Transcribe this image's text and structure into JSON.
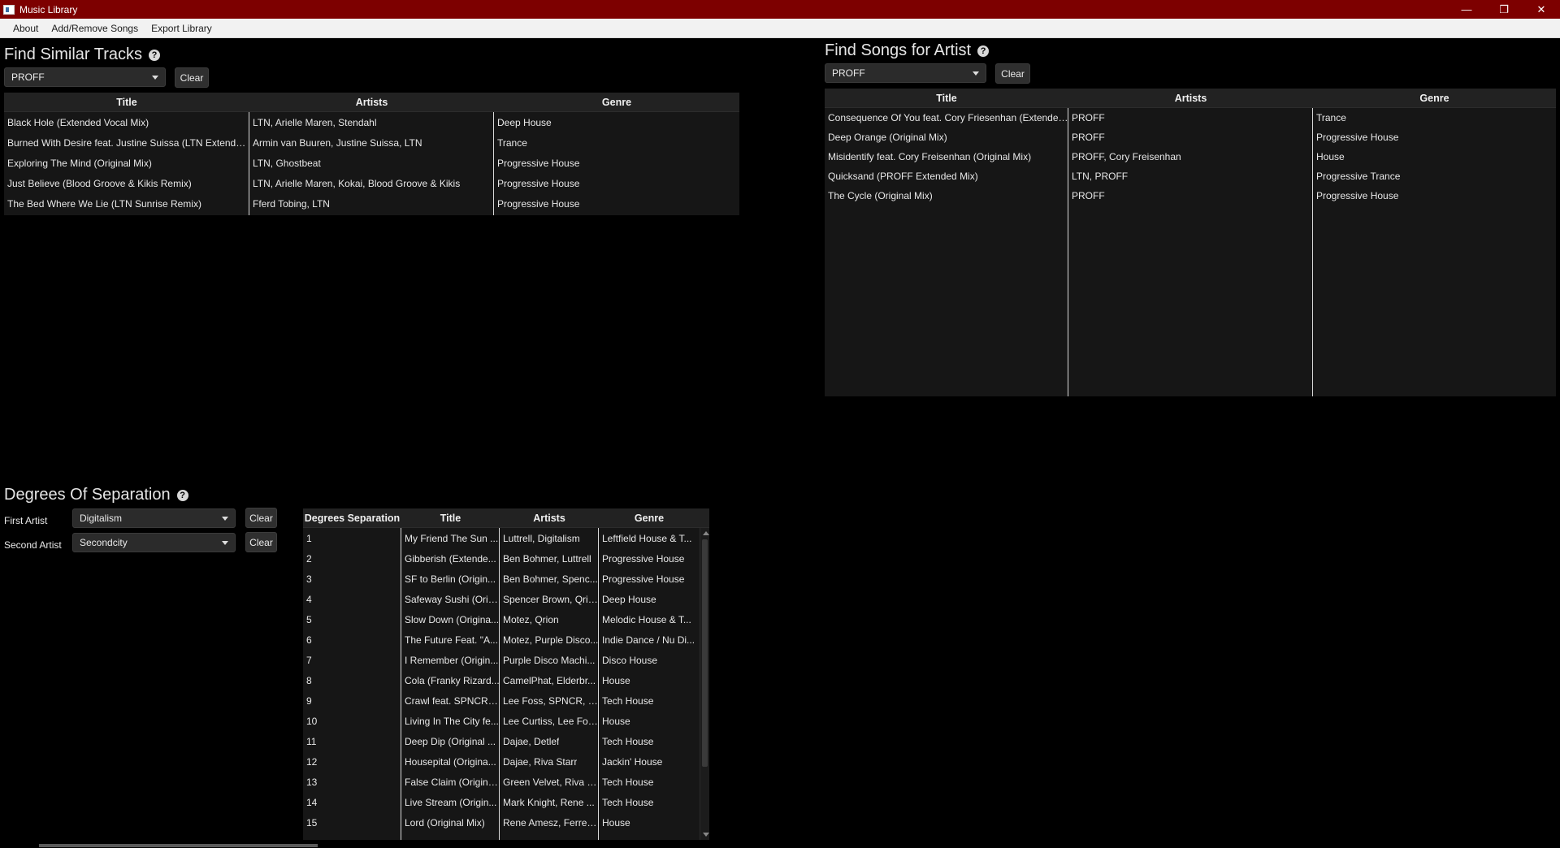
{
  "window": {
    "title": "Music Library",
    "minimize_glyph": "—",
    "restore_glyph": "❐",
    "close_glyph": "✕"
  },
  "menu": [
    "About",
    "Add/Remove Songs",
    "Export Library"
  ],
  "similar": {
    "title": "Find Similar Tracks",
    "selected_artist": "PROFF",
    "clear_label": "Clear",
    "columns": [
      "Title",
      "Artists",
      "Genre"
    ],
    "rows": [
      [
        "Black Hole (Extended Vocal Mix)",
        "LTN, Arielle Maren, Stendahl",
        "Deep House"
      ],
      [
        "Burned With Desire feat. Justine Suissa (LTN Extended...",
        "Armin van Buuren, Justine Suissa, LTN",
        "Trance"
      ],
      [
        "Exploring The Mind (Original Mix)",
        "LTN, Ghostbeat",
        "Progressive House"
      ],
      [
        "Just Believe (Blood Groove & Kikis Remix)",
        "LTN, Arielle Maren, Kokai, Blood Groove & Kikis",
        "Progressive House"
      ],
      [
        "The Bed Where We Lie (LTN Sunrise Remix)",
        "Fferd Tobing, LTN",
        "Progressive House"
      ]
    ]
  },
  "artist_songs": {
    "title": "Find Songs for Artist",
    "selected_artist": "PROFF",
    "clear_label": "Clear",
    "columns": [
      "Title",
      "Artists",
      "Genre"
    ],
    "rows": [
      [
        "Consequence Of You feat. Cory Friesenhan (Extended...",
        "PROFF",
        "Trance"
      ],
      [
        "Deep Orange (Original Mix)",
        "PROFF",
        "Progressive House"
      ],
      [
        "Misidentify feat. Cory Freisenhan (Original Mix)",
        "PROFF, Cory Freisenhan",
        "House"
      ],
      [
        "Quicksand (PROFF Extended Mix)",
        "LTN, PROFF",
        "Progressive Trance"
      ],
      [
        "The Cycle (Original Mix)",
        "PROFF",
        "Progressive House"
      ]
    ]
  },
  "degrees": {
    "title": "Degrees Of Separation",
    "first_label": "First Artist",
    "first_value": "Digitalism",
    "second_label": "Second Artist",
    "second_value": "Secondcity",
    "clear_label": "Clear",
    "columns": [
      "Degrees Separation",
      "Title",
      "Artists",
      "Genre"
    ],
    "rows": [
      [
        "1",
        "My Friend The Sun ...",
        "Luttrell, Digitalism",
        "Leftfield House & T..."
      ],
      [
        "2",
        "Gibberish (Extende...",
        "Ben Bohmer, Luttrell",
        "Progressive House"
      ],
      [
        "3",
        "SF to Berlin (Origin...",
        "Ben Bohmer, Spenc...",
        "Progressive House"
      ],
      [
        "4",
        "Safeway Sushi (Orig...",
        "Spencer Brown, Qrion",
        "Deep House"
      ],
      [
        "5",
        "Slow Down (Origina...",
        "Motez, Qrion",
        "Melodic House & T..."
      ],
      [
        "6",
        "The Future Feat. \"A...",
        "Motez, Purple Disco...",
        "Indie Dance / Nu Di..."
      ],
      [
        "7",
        "I Remember (Origin...",
        "Purple Disco Machi...",
        "Disco House"
      ],
      [
        "8",
        "Cola (Franky Rizard...",
        "CamelPhat, Elderbr...",
        "House"
      ],
      [
        "9",
        "Crawl feat. SPNCR f...",
        "Lee Foss, SPNCR, M...",
        "Tech House"
      ],
      [
        "10",
        "Living In The City fe...",
        "Lee Curtiss, Lee Fos...",
        "House"
      ],
      [
        "11",
        "Deep Dip (Original ...",
        "Dajae, Detlef",
        "Tech House"
      ],
      [
        "12",
        "Housepital (Origina...",
        "Dajae, Riva Starr",
        "Jackin' House"
      ],
      [
        "13",
        "False Claim (Origina...",
        "Green Velvet, Riva S...",
        "Tech House"
      ],
      [
        "14",
        "Live Stream (Origin...",
        "Mark Knight, Rene ...",
        "Tech House"
      ],
      [
        "15",
        "Lord (Original Mix)",
        "Rene Amesz, Ferrec...",
        "House"
      ]
    ]
  }
}
